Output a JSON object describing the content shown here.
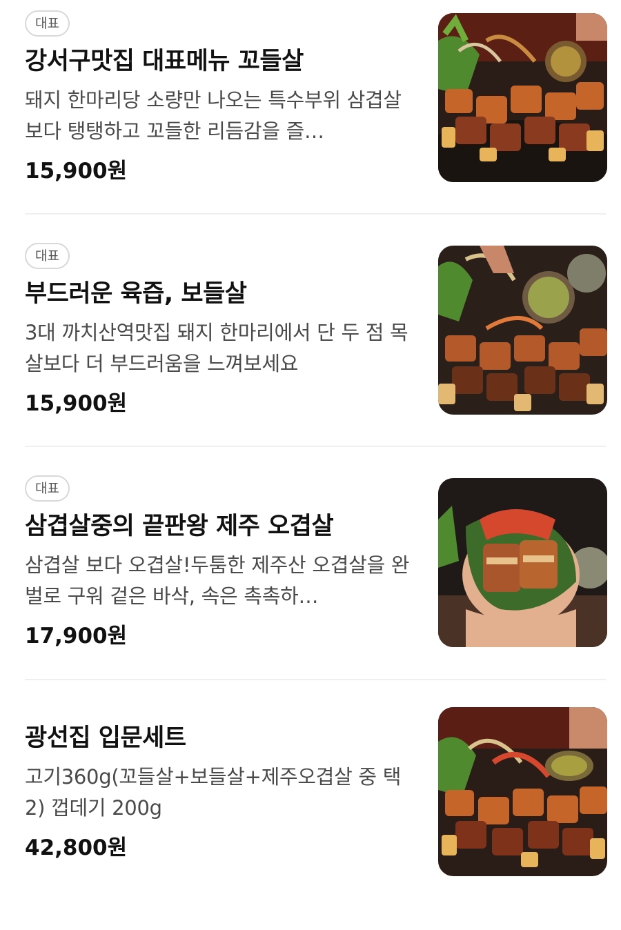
{
  "menu": {
    "items": [
      {
        "badge": "대표",
        "title": "강서구맛집 대표메뉴 꼬들살",
        "description": "돼지 한마리당 소량만 나오는 특수부위 삼겹살보다 탱탱하고 꼬들한 리듬감을 즐…",
        "price": "15,900원",
        "image_icon": "grilled-pork-platter-photo"
      },
      {
        "badge": "대표",
        "title": "부드러운 육즙, 보들살",
        "description": "3대 까치산역맛집 돼지 한마리에서 단 두 점 목살보다 더 부드러움을 느껴보세요",
        "price": "15,900원",
        "image_icon": "grilled-pork-platter-photo"
      },
      {
        "badge": "대표",
        "title": "삼겹살중의 끝판왕 제주 오겹살",
        "description": "삼겹살 보다 오겹살!두툼한 제주산 오겹살을 완벌로 구워 겉은 바삭, 속은 촉촉하…",
        "price": "17,900원",
        "image_icon": "pork-lettuce-wrap-photo"
      },
      {
        "badge": "",
        "title": "광선집 입문세트",
        "description": "고기360g(꼬들살+보들살+제주오겹살 중 택 2) 껍데기 200g",
        "price": "42,800원",
        "image_icon": "grilled-pork-platter-photo"
      }
    ]
  },
  "colors": {
    "text_primary": "#111111",
    "text_secondary": "#4a4a4a",
    "badge_border": "#d8d8d8",
    "divider": "#efefef"
  }
}
